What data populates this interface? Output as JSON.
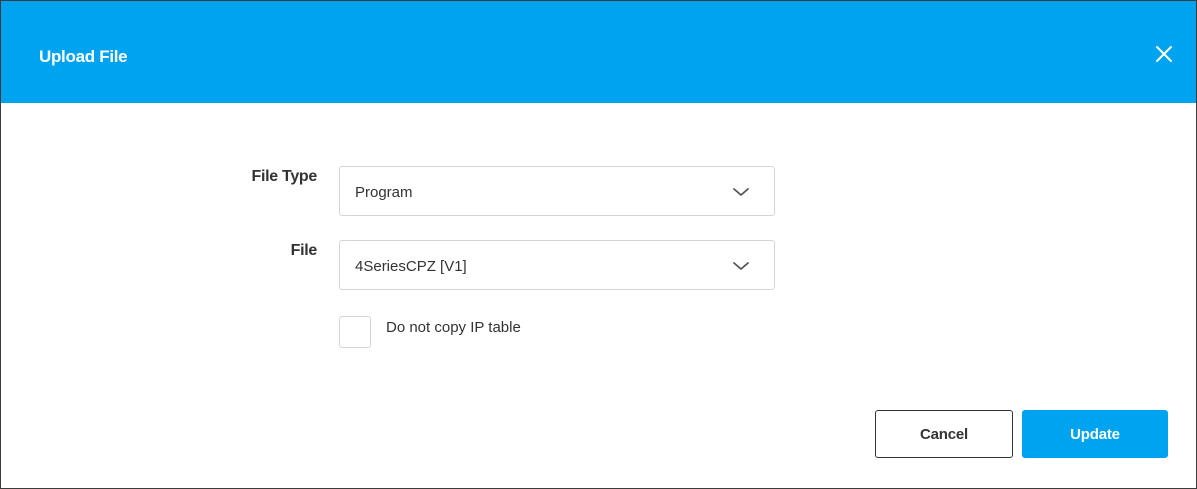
{
  "dialog": {
    "title": "Upload File",
    "close_icon": "close-icon"
  },
  "form": {
    "file_type": {
      "label": "File Type",
      "selected": "Program"
    },
    "file": {
      "label": "File",
      "selected": "4SeriesCPZ [V1]"
    },
    "checkbox": {
      "label": "Do not copy IP table",
      "checked": false
    }
  },
  "buttons": {
    "cancel": "Cancel",
    "update": "Update"
  },
  "colors": {
    "accent": "#00a3f0",
    "text": "#333333",
    "border": "#cfd6dc"
  }
}
